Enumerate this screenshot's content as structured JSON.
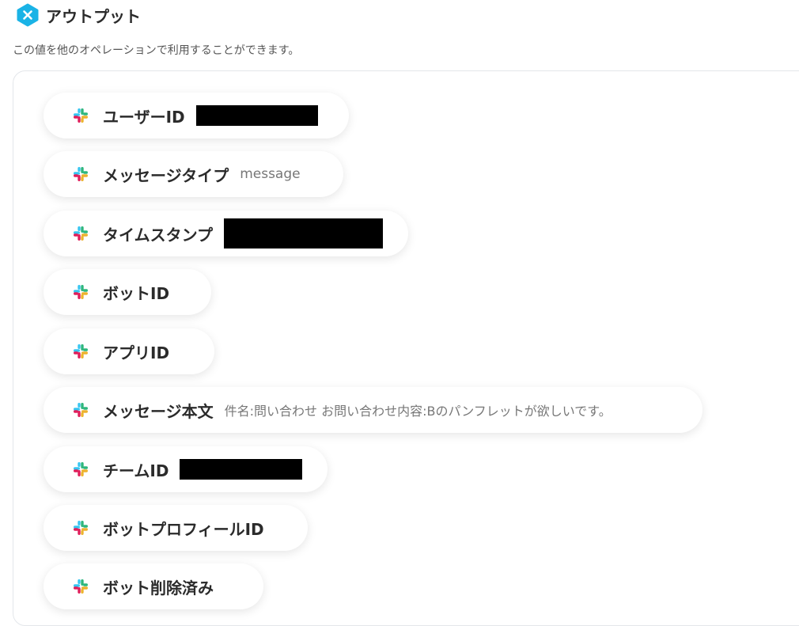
{
  "header": {
    "title": "アウトプット"
  },
  "description": "この値を他のオペレーションで利用することができます。",
  "colors": {
    "brand": "#1ab3e6",
    "slack_red": "#e01e5a",
    "slack_green": "#2eb67d",
    "slack_blue": "#36c5f0",
    "slack_yellow": "#ecb22e"
  },
  "outputs": [
    {
      "label": "ユーザーID",
      "value": "",
      "redacted": true
    },
    {
      "label": "メッセージタイプ",
      "value": "message",
      "redacted": false
    },
    {
      "label": "タイムスタンプ",
      "value": "",
      "redacted": true
    },
    {
      "label": "ボットID",
      "value": "",
      "redacted": false
    },
    {
      "label": "アプリID",
      "value": "",
      "redacted": false
    },
    {
      "label": "メッセージ本文",
      "value": "件名:問い合わせ お問い合わせ内容:Bのパンフレットが欲しいです。",
      "redacted": false
    },
    {
      "label": "チームID",
      "value": "",
      "redacted": true
    },
    {
      "label": "ボットプロフィールID",
      "value": "",
      "redacted": false
    },
    {
      "label": "ボット削除済み",
      "value": "",
      "redacted": false
    }
  ]
}
